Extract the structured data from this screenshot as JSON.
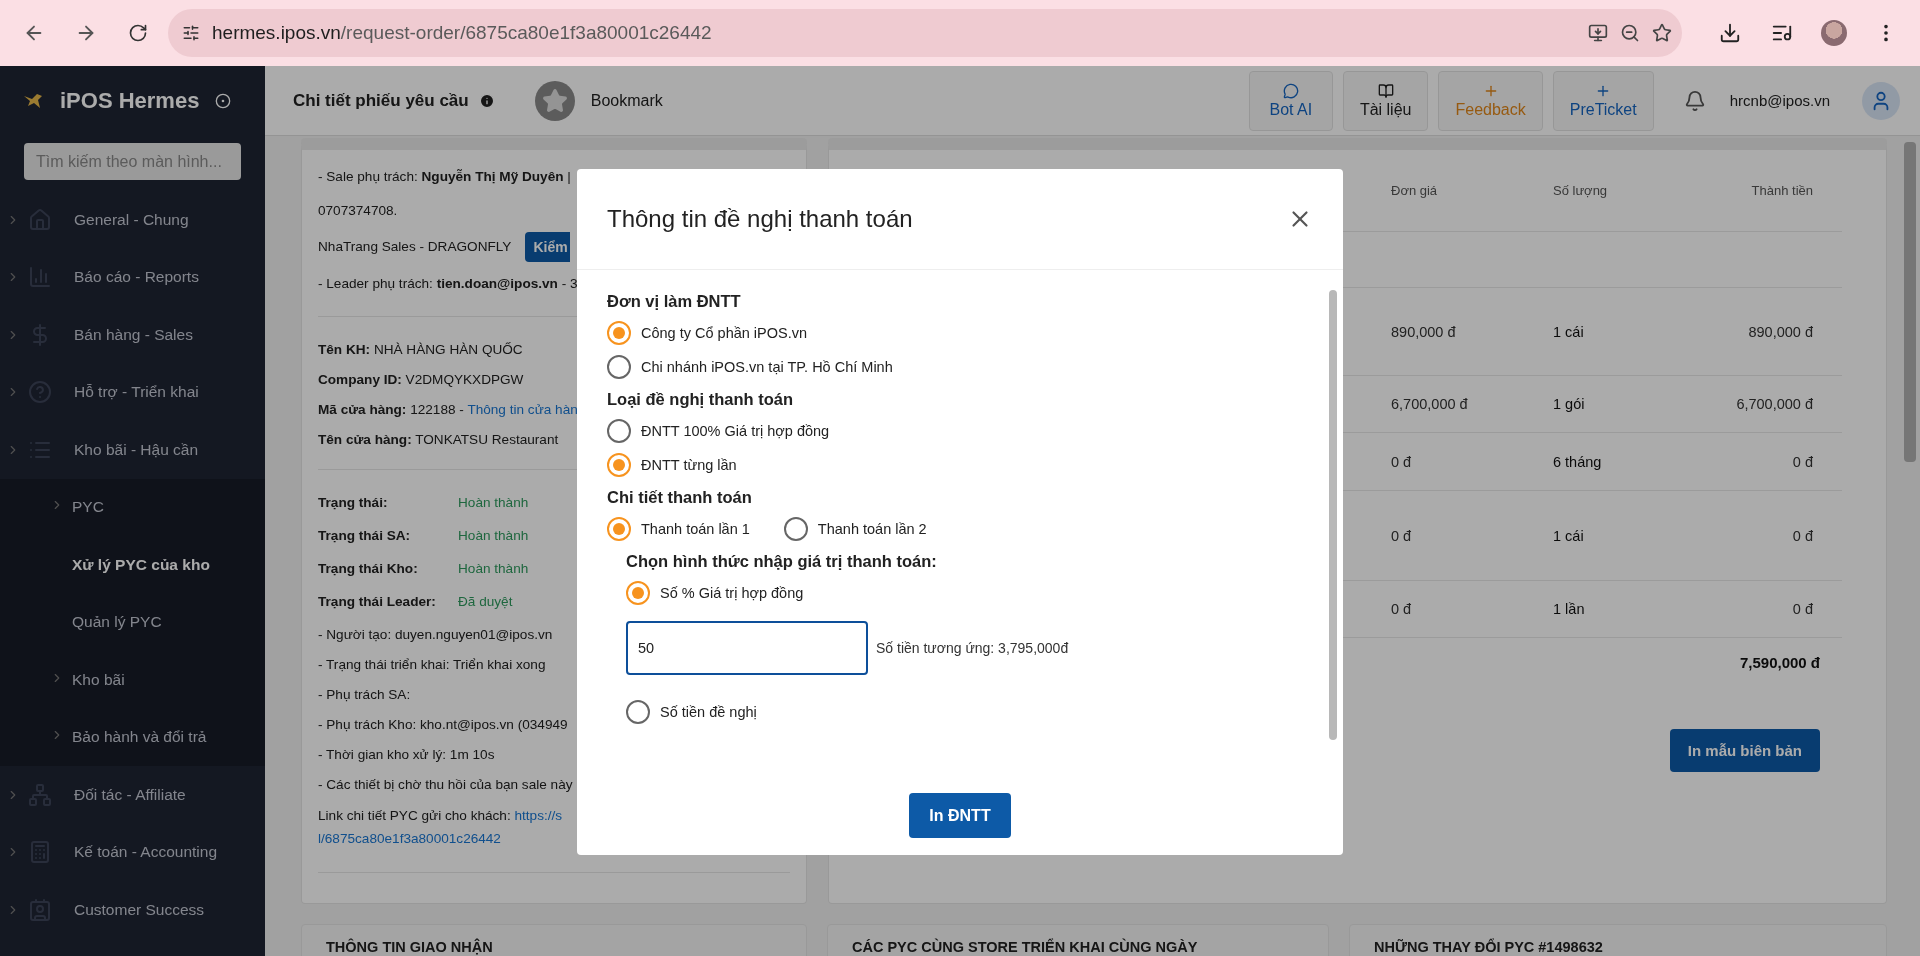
{
  "browser": {
    "url_host": "hermes.ipos.vn",
    "url_path": "/request-order/6875ca80e1f3a80001c26442"
  },
  "sidebar": {
    "brand": "iPOS Hermes",
    "search": {
      "placeholder": "Tìm kiếm theo màn hình..."
    },
    "items": [
      {
        "label": "General - Chung"
      },
      {
        "label": "Báo cáo - Reports"
      },
      {
        "label": "Bán hàng - Sales"
      },
      {
        "label": "Hỗ trợ - Triển khai"
      },
      {
        "label": "Kho bãi - Hậu cần",
        "children": [
          {
            "label": "PYC",
            "expandable": true,
            "selected": false
          },
          {
            "label": "Xử lý PYC của kho",
            "expandable": false,
            "selected": true
          },
          {
            "label": "Quản lý PYC",
            "expandable": false,
            "selected": false
          },
          {
            "label": "Kho bãi",
            "expandable": true,
            "selected": false
          },
          {
            "label": "Bảo hành và đổi trả",
            "expandable": true,
            "selected": false
          }
        ]
      },
      {
        "label": "Đối tác - Affiliate"
      },
      {
        "label": "Kế toán - Accounting"
      },
      {
        "label": "Customer Success"
      }
    ]
  },
  "header": {
    "title": "Chi tiết phiếu yêu cầu",
    "bookmark": "Bookmark",
    "buttons": [
      {
        "label": "Bot AI"
      },
      {
        "label": "Tài liệu"
      },
      {
        "label": "Feedback"
      },
      {
        "label": "PreTicket"
      }
    ],
    "user": "hrcnb@ipos.vn"
  },
  "details": {
    "contact_lines": [
      "- Sale phụ trách: **Nguyễn Thị Mỹ Duyên** |",
      "0707374708."
    ],
    "team": "NhaTrang Sales - DRAGONFLY",
    "check_button": "Kiểm",
    "leader": "- Leader phụ trách: **tien.doan@ipos.vn** - 3",
    "customer_lines": [
      "**Tên KH:** NHÀ HÀNG HÀN QUỐC",
      "**Company ID:** V2DMQYKXDPGW"
    ],
    "store_code": "**Mã cửa hàng:** 122188 - ",
    "store_link": "Thông tin cửa hàn",
    "store_name": "**Tên cửa hàng:** TONKATSU Restaurant",
    "statuses": [
      {
        "label": "Trạng thái:",
        "value": "Hoàn thành"
      },
      {
        "label": "Trạng thái SA:",
        "value": "Hoàn thành"
      },
      {
        "label": "Trạng thái Kho:",
        "value": "Hoàn thành"
      },
      {
        "label": "Trạng thái Leader:",
        "value": "Đã duyệt"
      }
    ],
    "notes": [
      "- Người tạo: duyen.nguyen01@ipos.vn",
      "- Trạng thái triển khai: Triển khai xong",
      "- Phụ trách SA:",
      "- Phụ trách Kho: kho.nt@ipos.vn (034949",
      "- Thời gian kho xử lý: 1m 10s",
      "- Các thiết bị chờ thu hồi của bạn sale này"
    ],
    "share_label": "Link chi tiết PYC gửi cho khách: ",
    "share_link": [
      "https://s",
      "l/6875ca80e1f3a80001c26442"
    ]
  },
  "items_table": {
    "columns": [
      "Đơn giá",
      "Số lượng",
      "Thành tiền"
    ],
    "rows": [
      {
        "unit_price": "890,000 đ",
        "quantity": "1 cái",
        "amount": "890,000 đ"
      },
      {
        "unit_price": "6,700,000 đ",
        "quantity": "1 gói",
        "amount": "6,700,000 đ"
      },
      {
        "unit_price": "0 đ",
        "quantity": "6 tháng",
        "amount": "0 đ"
      },
      {
        "unit_price": "0 đ",
        "quantity": "1 cái",
        "amount": "0 đ"
      },
      {
        "unit_price": "0 đ",
        "quantity": "1 lần",
        "amount": "0 đ"
      }
    ],
    "total": "7,590,000 đ",
    "print_button": "In mẫu biên bản"
  },
  "bottom_sections": [
    "THÔNG TIN GIAO NHẬN",
    "CÁC PYC CÙNG STORE TRIỂN KHAI CÙNG NGÀY",
    "NHỮNG THAY ĐỔI PYC #1498632"
  ],
  "payment_dialog": {
    "title": "Thông tin đề nghị thanh toán",
    "groups": [
      {
        "heading": "Đơn vị làm ĐNTT",
        "kind": "stacked",
        "options": [
          {
            "label": "Công ty Cổ phần iPOS.vn",
            "selected": true
          },
          {
            "label": "Chi nhánh iPOS.vn tại TP. Hồ Chí Minh",
            "selected": false
          }
        ]
      },
      {
        "heading": "Loại đề nghị thanh toán",
        "kind": "stacked",
        "options": [
          {
            "label": "ĐNTT 100% Giá trị hợp đồng",
            "selected": false
          },
          {
            "label": "ĐNTT từng lần",
            "selected": true
          }
        ]
      },
      {
        "heading": "Chi tiết thanh toán",
        "kind": "inline",
        "options": [
          {
            "label": "Thanh toán lần 1",
            "selected": true
          },
          {
            "label": "Thanh toán lần 2",
            "selected": false
          }
        ]
      }
    ],
    "input_method": {
      "heading": "Chọn hình thức nhập giá trị thanh toán:",
      "options": [
        {
          "label": "Số % Giá trị hợp đồng",
          "selected": true,
          "value": "50",
          "note": "Số tiền tương ứng: 3,795,000đ"
        },
        {
          "label": "Số tiền đề nghị",
          "selected": false
        }
      ]
    },
    "submit": "In ĐNTT"
  }
}
